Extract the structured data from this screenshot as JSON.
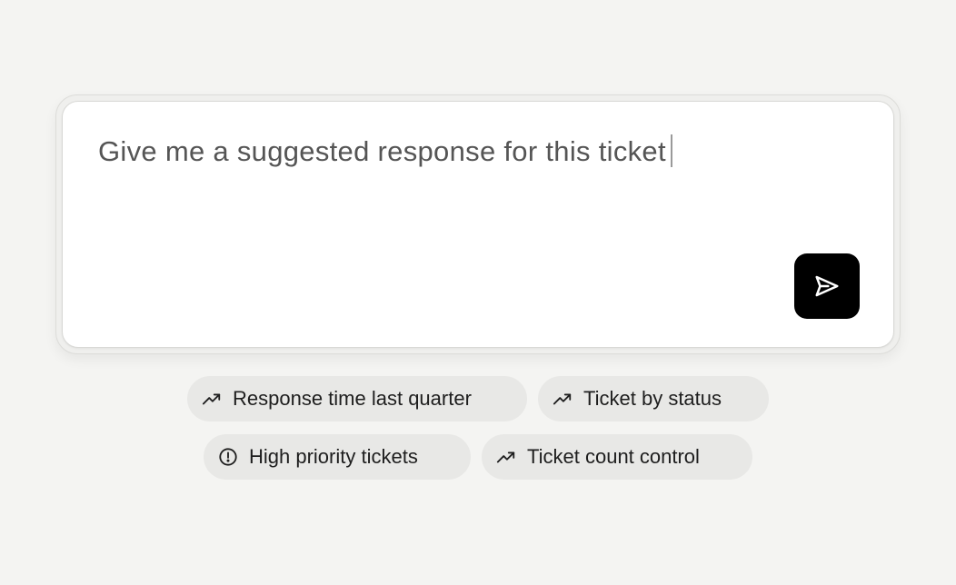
{
  "prompt": {
    "text": "Give me a suggested response for this ticket"
  },
  "send": {
    "icon": "send-icon",
    "button_color": "#000000"
  },
  "suggestions": [
    {
      "label": "Response time last quarter",
      "icon": "trending-up-icon"
    },
    {
      "label": "Ticket by status",
      "icon": "trending-up-icon"
    },
    {
      "label": "High priority tickets",
      "icon": "alert-circle-icon"
    },
    {
      "label": "Ticket count control",
      "icon": "trending-up-icon"
    }
  ]
}
